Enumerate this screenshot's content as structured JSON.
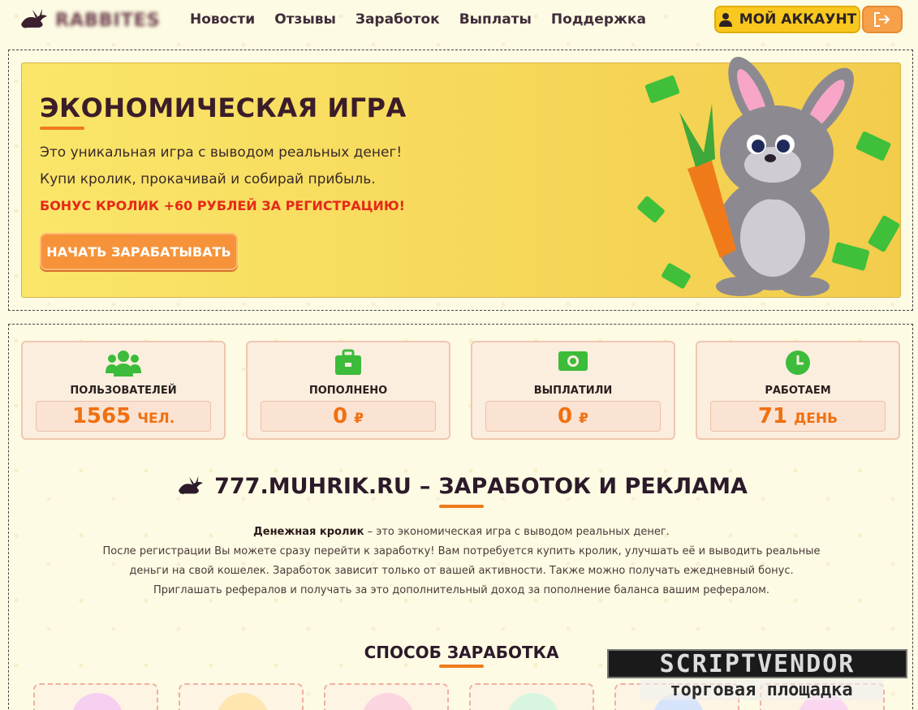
{
  "header": {
    "logo_text": "RABBITES",
    "nav": [
      {
        "label": "Новости"
      },
      {
        "label": "Отзывы"
      },
      {
        "label": "Заработок"
      },
      {
        "label": "Выплаты"
      },
      {
        "label": "Поддержка"
      }
    ],
    "account_label": "МОЙ АККАУНТ"
  },
  "hero": {
    "title": "ЭКОНОМИЧЕСКАЯ ИГРА",
    "line1": "Это уникальная игра с выводом реальных денег!",
    "line2": "Купи кролик, прокачивай и собирай прибыль.",
    "bonus": "БОНУС КРОЛИК +60 РУБЛЕЙ ЗА РЕГИСТРАЦИЮ!",
    "cta": "НАЧАТЬ ЗАРАБАТЫВАТЬ"
  },
  "stats": [
    {
      "label": "ПОЛЬЗОВАТЕЛЕЙ",
      "value": "1565",
      "unit": "ЧЕЛ.",
      "icon": "users-icon"
    },
    {
      "label": "ПОПОЛНЕНО",
      "value": "0",
      "unit": "₽",
      "icon": "briefcase-icon"
    },
    {
      "label": "ВЫПЛАТИЛИ",
      "value": "0",
      "unit": "₽",
      "icon": "money-icon"
    },
    {
      "label": "РАБОТАЕМ",
      "value": "71",
      "unit": "ДЕНЬ",
      "icon": "clock-icon"
    }
  ],
  "about": {
    "site": "777.MUHRIK.RU",
    "dash": "–",
    "heading": "ЗАРАБОТОК И РЕКЛАМА",
    "bold_lead": "Денежная кролик",
    "line1": " – это экономическая игра с выводом реальных денег.",
    "line2": "После регистрации Вы можете сразу перейти к заработку! Вам потребуется купить кролик, улучшать её и выводить реальные деньги на свой кошелек. Заработок зависит только от вашей активности. Также можно получать ежедневный бонус. Приглашать рефералов и получать за это дополнительный доход за пополнение баланса вашим рефералом."
  },
  "methods_title": "СПОСОБ ЗАРАБОТКА",
  "watermark": {
    "title": "SCRIPTVENDOR",
    "subtitle": "торговая площадка"
  },
  "colors": {
    "accent": "#f07a1a",
    "yellow": "#f9c81e",
    "bonus_red": "#e42a1a",
    "icon_green": "#3dbb3a"
  }
}
